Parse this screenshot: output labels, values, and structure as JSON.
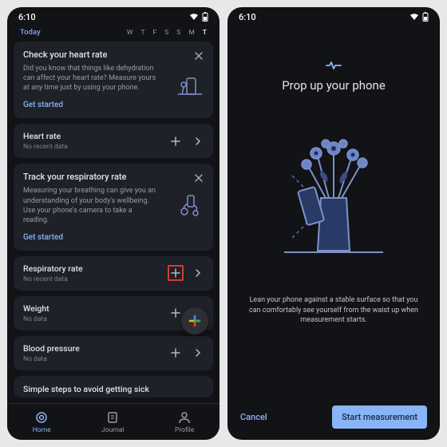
{
  "status": {
    "time": "6:10"
  },
  "screen1": {
    "today_label": "Today",
    "days": [
      "W",
      "T",
      "F",
      "S",
      "S",
      "M",
      "T"
    ],
    "heart_promo": {
      "title": "Check your heart rate",
      "body": "Did you know that things like dehydration can affect your heart rate? Measure yours at any time just by using your phone.",
      "cta": "Get started"
    },
    "metrics": {
      "heart": {
        "title": "Heart rate",
        "sub": "No recent data"
      },
      "resp_promo": {
        "title": "Track your respiratory rate",
        "body": "Measuring your breathing can give you an understanding of your body's wellbeing. Use your phone's camera to take a reading.",
        "cta": "Get started"
      },
      "resp": {
        "title": "Respiratory rate",
        "sub": "No recent data"
      },
      "weight": {
        "title": "Weight",
        "sub": "No data"
      },
      "bp": {
        "title": "Blood pressure",
        "sub": "No data"
      }
    },
    "tips_title": "Simple steps to avoid getting sick",
    "nav": {
      "home": "Home",
      "journal": "Journal",
      "profile": "Profile"
    }
  },
  "screen2": {
    "title": "Prop up your phone",
    "desc": "Lean your phone against a stable surface so that you can comfortably see yourself from the waist up when measurement starts.",
    "cancel": "Cancel",
    "start": "Start measurement"
  }
}
